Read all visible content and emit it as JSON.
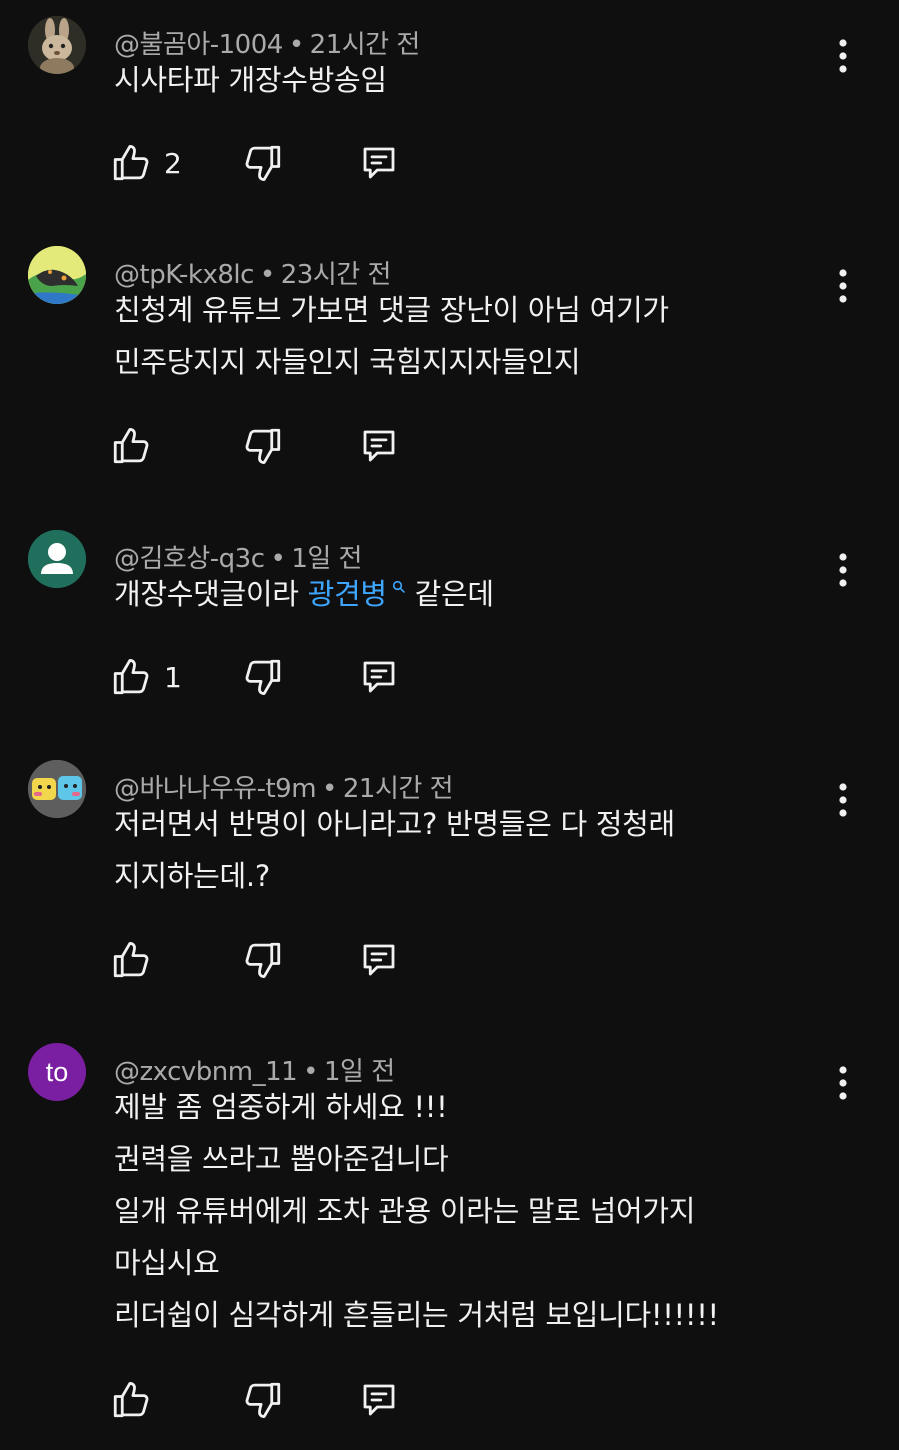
{
  "comments": [
    {
      "author": "@불곰아-1004",
      "time": "21시간 전",
      "lines": [
        "시사타파 개장수방송임"
      ],
      "likes": "2",
      "avatar": {
        "type": "image",
        "desc": "rabbit-avatar",
        "bg": "#3a3a30"
      }
    },
    {
      "author": "@tpK-kx8lc",
      "time": "23시간 전",
      "lines": [
        "친청계 유튜브 가보면 댓글 장난이 아님 여기가",
        "민주당지지 자들인지 국힘지지자들인지"
      ],
      "likes": "",
      "avatar": {
        "type": "image",
        "desc": "frog-avatar",
        "bg": "#d8e36a"
      }
    },
    {
      "author": "@김호상-q3c",
      "time": "1일 전",
      "line_prefix": "개장수댓글이라 ",
      "link_text": "광견병",
      "line_suffix": " 같은데",
      "likes": "1",
      "avatar": {
        "type": "default",
        "bg": "#1f6f5c"
      }
    },
    {
      "author": "@바나나우유-t9m",
      "time": "21시간 전",
      "lines": [
        "저러면서 반명이 아니라고? 반명들은 다 정청래",
        "지지하는데.?"
      ],
      "likes": "",
      "avatar": {
        "type": "image",
        "desc": "cartoon-avatar",
        "bg": "#6a6a6a"
      }
    },
    {
      "author": "@zxcvbnm_11",
      "time": "1일 전",
      "lines": [
        "제발 좀 엄중하게 하세요 !!!",
        "권력을 쓰라고 뽑아준겁니다",
        "일개 유튜버에게 조차 관용 이라는 말로 넘어가지",
        "마십시요",
        "리더쉽이 심각하게 흔들리는 거처럼 보입니다!!!!!!"
      ],
      "likes": "",
      "avatar": {
        "type": "letters",
        "letters": "to",
        "bg": "#7b1fa2"
      }
    }
  ],
  "meta_separator": "•",
  "icons": {
    "like": "thumbs-up-icon",
    "dislike": "thumbs-down-icon",
    "reply": "reply-comment-icon",
    "more": "more-vertical-icon",
    "search": "search-icon"
  },
  "colors": {
    "background": "#0f0f0f",
    "text": "#f1f1f1",
    "meta": "#aaaaaa",
    "link": "#3ea6ff"
  }
}
